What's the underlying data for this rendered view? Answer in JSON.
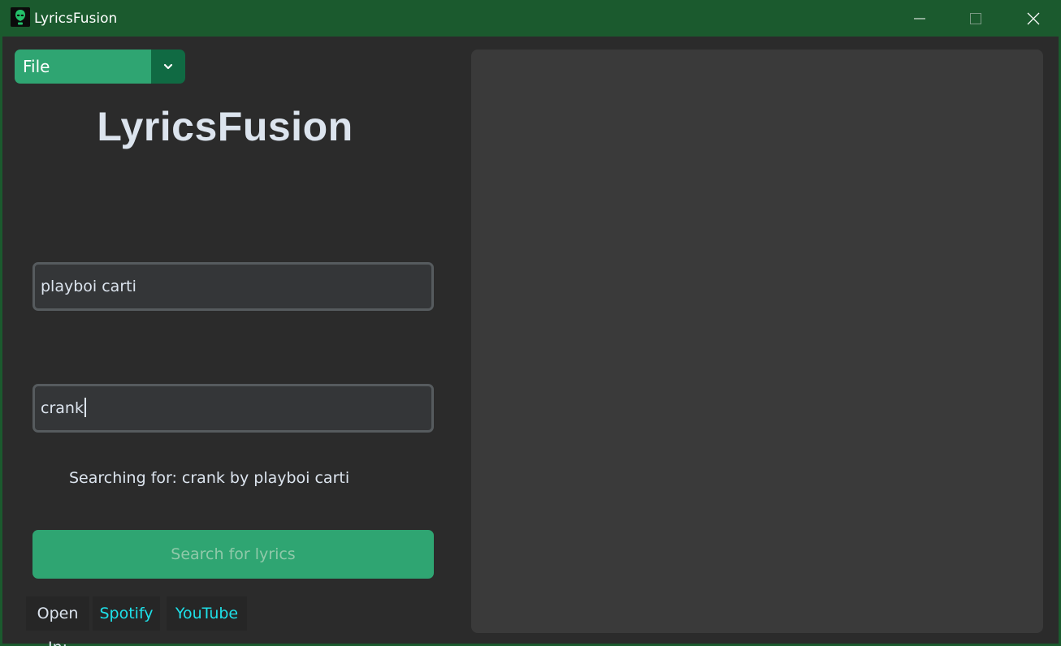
{
  "window": {
    "title": "LyricsFusion",
    "app_icon": "alien-icon"
  },
  "menu": {
    "file_label": "File",
    "dropdown_icon": "chevron-down-icon"
  },
  "main": {
    "app_title": "LyricsFusion",
    "artist_value": "playboi carti",
    "song_value": "crank",
    "status_text": "Searching for: crank by playboi carti",
    "search_button_label": "Search for lyrics",
    "open_in_label": "Open In:",
    "spotify_label": "Spotify",
    "youtube_label": "YouTube"
  },
  "lyrics": {
    "text": ""
  },
  "colors": {
    "titlebar": "#1b5a2e",
    "background": "#2b2b2b",
    "accent": "#2fa572",
    "accent_dark": "#106a43",
    "entry_bg": "#343638",
    "entry_border": "#565b5e",
    "link_text": "#1ee0e8",
    "lyrics_panel": "#3a3a3a"
  }
}
